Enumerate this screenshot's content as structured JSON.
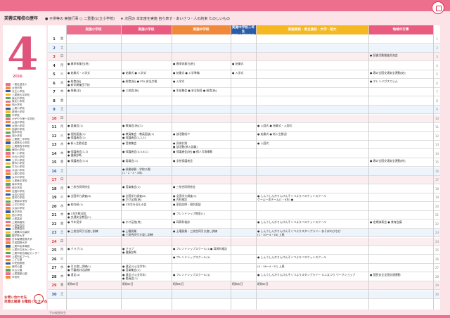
{
  "header": {
    "title": "芙蓉広報校の歴年",
    "legend": "● 子供等の 実施行事 ○ 二重重(公立小学校) 　 ★ 次回の 本年度を実施 自ら表す・あいさつ・人の約束 たのしいもの"
  },
  "calendar": {
    "month": "4",
    "year": "2016"
  },
  "columns": [
    {
      "label": "実施小学校",
      "color": "#ec6f8e"
    },
    {
      "label": "実施小学校",
      "color": "#e95b7f"
    },
    {
      "label": "実施中学校",
      "color": "#f08a3a"
    },
    {
      "label": "実施中学校二年生\n実施中学校三年生",
      "color": "#2a5ca8"
    },
    {
      "label": "実施高校・県立高校・大学・短大",
      "color": "#f5b820"
    },
    {
      "label": "地域の行事",
      "color": "#e95b7f"
    }
  ],
  "sidebar_items": [
    "一般社団法人",
    "太田市長",
    "天王小学校",
    "上尾第五中学校",
    "東北中学校",
    "東北小学校",
    "旭小学校",
    "上尾小学校",
    "新田小学校",
    "中学校",
    "かがやき第一中学校",
    "太田中学校",
    "太田小学校",
    "西部中学校",
    "旭中学校",
    "旭小学校",
    "上尾第二中学校",
    "上尾第五小学校",
    "上尾第四中学校",
    "東町小学校",
    "第一小学校",
    "大石小学校",
    "上平小学校",
    "原市小学校",
    "平方小学校",
    "大谷小学校",
    "上尾中学校",
    "太平中学校",
    "上尾東中学校",
    "南中学校",
    "西中学校",
    "瓦葺中学校",
    "大石中学校",
    "原市中学校",
    "上尾南中学校",
    "上平中学校",
    "大谷中学校",
    "東中学校",
    "西小学校",
    "上尾高校",
    "上尾南高校",
    "上尾東高校",
    "上尾橘高校",
    "上尾鷹の台高校",
    "聖学院大学",
    "日本保健医療大学",
    "平成国際大学",
    "上尾市民体育館",
    "上尾市文化センター",
    "上尾市総合福祉センター",
    "上尾市民プール",
    "こども館",
    "中央図書館",
    "東町公園",
    "丸山公園",
    "上尾運動公園",
    "市役所"
  ],
  "rows": [
    {
      "day": "1",
      "wd": "金",
      "type": "",
      "cells": [
        "",
        "",
        "",
        "",
        "",
        ""
      ]
    },
    {
      "day": "2",
      "wd": "土",
      "type": "sat",
      "cells": [
        "",
        "",
        "",
        "",
        "",
        ""
      ]
    },
    {
      "day": "3",
      "wd": "日",
      "type": "sun",
      "cells": [
        "",
        "",
        "",
        "",
        "",
        "● 読書活動推進交流会"
      ]
    },
    {
      "day": "4",
      "wd": "月",
      "type": "",
      "cells": [
        "● 春季休業日[終]",
        "",
        "● 春季休業日[終]",
        "● 始業式",
        "",
        ""
      ]
    },
    {
      "day": "5",
      "wd": "火",
      "type": "",
      "cells": [
        "● 始業式・入学式",
        "● 始業式 ● 入学式",
        "● 始業式 ● 入学準備",
        "● 入学式",
        "",
        "● 春の全国交通安全運動[始]"
      ]
    },
    {
      "day": "6",
      "wd": "水",
      "type": "",
      "cells": [
        "● 給食[始]\n● 新学期集団下校",
        "● 給食[始] ● PTA 安全点検",
        "● 入学式",
        "",
        "",
        "● オレンジガスてらん"
      ]
    },
    {
      "day": "7",
      "wd": "木",
      "type": "",
      "cells": [
        "● 授業(全)",
        "● 三校会[始]",
        "● 生徒集会 ● 安全指導 ● 給食[始]",
        "",
        "",
        ""
      ]
    },
    {
      "day": "8",
      "wd": "金",
      "type": "",
      "cells": [
        "",
        "",
        "",
        "",
        "",
        ""
      ]
    },
    {
      "day": "9",
      "wd": "土",
      "type": "sat",
      "cells": [
        "",
        "",
        "",
        "",
        "",
        ""
      ]
    },
    {
      "day": "10",
      "wd": "日",
      "type": "sun",
      "cells": [
        "",
        "",
        "",
        "",
        "",
        ""
      ]
    },
    {
      "day": "11",
      "wd": "月",
      "type": "",
      "cells": [
        "● 委員会(1)",
        "● 教員会[始](1)",
        "",
        "",
        "● 入園式 ● 始業式・入園式",
        ""
      ]
    },
    {
      "day": "12",
      "wd": "火",
      "type": "",
      "cells": [
        "● 個別面談(1)\n● 保護者会(1)",
        "● 教員集会・教員面談(1)\n● 保護者会(1,2,3)",
        "● 部活動紹介",
        "",
        "● 始業式 ● 新入生歓迎",
        ""
      ]
    },
    {
      "day": "13",
      "wd": "水",
      "type": "",
      "cells": [
        "● 新入生歓迎会",
        "● 音楽集会",
        "● 身体計測\n● 部活動(新入部員)",
        "",
        "● 入園式",
        ""
      ]
    },
    {
      "day": "14",
      "wd": "木",
      "type": "",
      "cells": [
        "● 保護者会(1,2)\n● 健康診断",
        "● 保護者会(4,5,6,C)",
        "● 保護者会[始] ● 個人写真撮影",
        "",
        "",
        ""
      ]
    },
    {
      "day": "15",
      "wd": "金",
      "type": "",
      "cells": [
        "● 保護者会(3,4)",
        "● 委員会(1)",
        "● 全校保護者会",
        "",
        "",
        "● 春の全国交通安全運動[終]"
      ]
    },
    {
      "day": "16",
      "wd": "土",
      "type": "sat",
      "cells": [
        "",
        "● 授業参観・学校公開\n(1・2・3・4年)",
        "",
        "",
        "",
        ""
      ]
    },
    {
      "day": "17",
      "wd": "日",
      "type": "sun",
      "cells": [
        "",
        "",
        "",
        "",
        "",
        ""
      ]
    },
    {
      "day": "18",
      "wd": "月",
      "type": "",
      "cells": [
        "● 三校合同研修会",
        "● 音楽集会(1)",
        "● 三校合同研修会",
        "",
        "",
        ""
      ]
    },
    {
      "day": "19",
      "wd": "火",
      "type": "",
      "cells": [
        "● 全国学力調査(6)",
        "● 全国学力調査(6)\n● かけ足旅[始]",
        "● 全国学力調査(3)\n● 内科検診",
        "",
        "● しんうしんかりんけんそくつよりバスケットスクール\nゲーム一本チーム(1・6年) ●",
        ""
      ]
    },
    {
      "day": "20",
      "wd": "水",
      "type": "",
      "cells": [
        "● 校内研(1)",
        "● 1年生を迎える会",
        "● 家庭訪問・個別面談",
        "",
        "",
        ""
      ]
    },
    {
      "day": "21",
      "wd": "木",
      "type": "",
      "cells": [
        "● 1年生歓迎会\n● 交通安全教室(1)",
        "",
        "● フレンドシップ教室(1)",
        "",
        "",
        ""
      ]
    },
    {
      "day": "22",
      "wd": "金",
      "type": "",
      "cells": [
        "● 今年見学",
        "● かけ足旅[終]",
        "● 耳鼻科検診",
        "",
        "● しんうしんかりんけんそくつよりバスケットスクール",
        "● 定期演奏会 ● 食育会議"
      ]
    },
    {
      "day": "23",
      "wd": "土",
      "type": "sat",
      "cells": [
        "● 三校合同引き渡し訓練",
        "● 土曜授業\n● 三校合同引き渡し訓練",
        "● 土曜授業・三校合同引き渡し訓練",
        "",
        "● しんうしんかりんけんそくつよりスタンプラリー あそぼのびなび\n(1・10〜4・16) 上尾",
        ""
      ]
    },
    {
      "day": "24",
      "wd": "日",
      "type": "sun",
      "cells": [
        "",
        "",
        "",
        "",
        "",
        ""
      ]
    },
    {
      "day": "25",
      "wd": "月",
      "type": "",
      "cells": [
        "● クラブ(1)",
        "● クラブ\n● 健康診断",
        "● フレンドシップスクール(1)● 耳鼻科検診",
        "",
        "",
        ""
      ]
    },
    {
      "day": "26",
      "wd": "火",
      "type": "",
      "cells": [
        "",
        "",
        "● フレンドシップスクール(1)",
        "",
        "● しんうしんかりんけんそくつよりバスケットスクール",
        ""
      ]
    },
    {
      "day": "27",
      "wd": "水",
      "type": "",
      "cells": [
        "● 引き渡し訓練(1)\n● 不審者対応訓練",
        "● 遠足(小)(全学年)\n● 音楽集会(1)",
        "",
        "",
        "(4・16〜4・31) 上尾",
        ""
      ]
    },
    {
      "day": "28",
      "wd": "木",
      "type": "",
      "cells": [
        "● 遠足(4)",
        "● 遠足(小)(全学年)\n● 委員会(1)",
        "● フレンドシップスクール(1)",
        "",
        "● しんうしんかりんけんそくつよりスタンプラリー ミニまつり ワークショップ",
        "● 国民安全全国交通運動"
      ]
    },
    {
      "day": "29",
      "wd": "金",
      "type": "holiday",
      "cells": [
        "昭和の日",
        "昭和の日",
        "昭和の日",
        "昭和の日",
        "昭和の日",
        ""
      ]
    },
    {
      "day": "30",
      "wd": "土",
      "type": "sat",
      "cells": [
        "",
        "",
        "",
        "",
        "",
        ""
      ]
    }
  ],
  "contact": "お問い合わせ先\n芙蓉広報課 お電話くださいね",
  "footer": "子の校長先生"
}
